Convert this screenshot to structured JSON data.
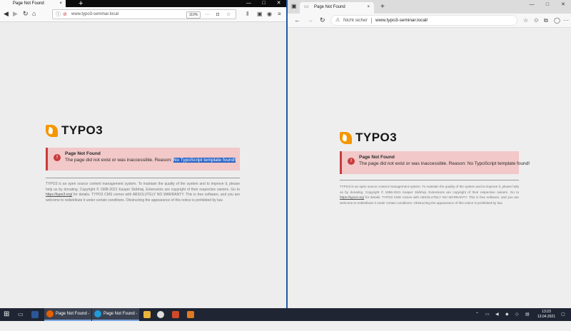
{
  "firefox": {
    "tab_title": "Page Not Found",
    "tab_close": "×",
    "new_tab": "+",
    "url": "www.typo3-seminar.local",
    "zoom": "110%",
    "window_buttons": [
      "—",
      "□",
      "✕"
    ],
    "alert": {
      "title": "Page Not Found",
      "message": "The page did not exist or was inaccessible. Reason: ",
      "reason": "No TypoScript template found!"
    },
    "footer": {
      "before_link": "TYPO3 is an open source content management system. To maintain the quality of the system and to improve it, please help us by donating. Copyright © 1998-2021 Kasper Skårhøj. Extensions are copyright of their respective owners. Go to ",
      "link": "https://typo3.org/",
      "after_link": " for details. TYPO3 CMS comes with ABSOLUTELY NO WARRANTY. This is free software, and you are welcome to redistribute it under certain conditions. Obstructing the appearance of this notice is prohibited by law."
    }
  },
  "edge": {
    "tab_title": "Page Not Found",
    "tab_close": "×",
    "new_tab": "+",
    "security_label": "Nicht sicher",
    "url": "www.typo3-seminar.local/",
    "window_buttons": [
      "—",
      "□",
      "✕"
    ],
    "alert": {
      "title": "Page Not Found",
      "message": "The page did not exist or was inaccessible. Reason: No TypoScript template found!"
    },
    "footer": {
      "before_link": "TYPO3 is an open source content management system. To maintain the quality of the system and to improve it, please help us by donating. Copyright © 1998-2021 Kasper Skårhøj. Extensions are copyright of their respective owners. Go to ",
      "link": "https://typo3.org/",
      "after_link": " for details. TYPO3 CMS comes with ABSOLUTELY NO WARRANTY. This is free software, and you are welcome to redistribute it under certain conditions. Obstructing the appearance of this notice is prohibited by law."
    }
  },
  "logo_text": "TYPO3",
  "taskbar": {
    "apps": [
      {
        "label": "Page Not Found - ..."
      },
      {
        "label": "Page Not Found - ..."
      }
    ],
    "time": "13:23",
    "date": "13.04.2021"
  },
  "colors": {
    "alert_bg": "#f2c8c8",
    "alert_accent": "#c83c3c",
    "typo3_orange": "#f49700",
    "selection": "#2a64c5",
    "taskbar": "#1f2533"
  }
}
